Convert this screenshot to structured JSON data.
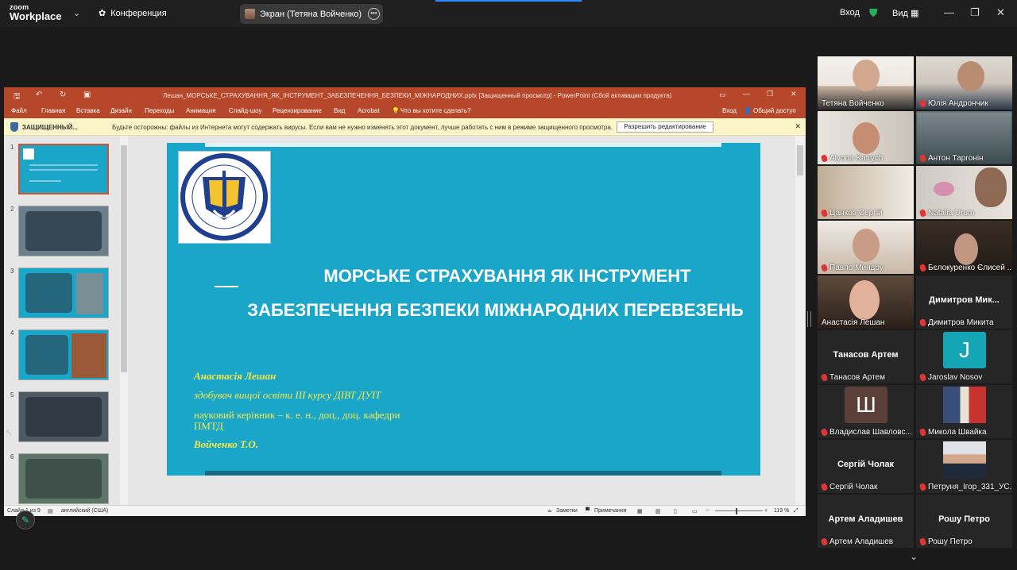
{
  "zoom": {
    "logo_line1": "zoom",
    "logo_line2": "Workplace",
    "meeting_label": "Конференция",
    "screen_share_label": "Экран (Тетяна Войченко)",
    "signin": "Вход",
    "view": "Вид"
  },
  "ppt": {
    "title": "Лешан_МОРСЬКЕ_СТРАХУВАННЯ_ЯК_ІНСТРУМЕНТ_ЗАБЕЗПЕЧЕННЯ_БЕЗПЕКИ_МІЖНАРОДНИХ.pptx [Защищенный просмотр] - PowerPoint (Сбой активации продукта)",
    "ribbon": [
      "Файл",
      "Главная",
      "Вставка",
      "Дизайн",
      "Переходы",
      "Анимация",
      "Слайд-шоу",
      "Рецензирование",
      "Вид",
      "Acrobat"
    ],
    "tell_me": "Что вы хотите сделать?",
    "signin": "Вход",
    "share": "Общий доступ",
    "warn_label": "ЗАЩИЩЕННЫЙ...",
    "warn_msg": "Будьте осторожны: файлы из Интернета могут содержать вирусы. Если вам не нужно изменять этот документ, лучше работать с ним в режиме защищенного просмотра.",
    "enable_edit": "Разрешить редактирование",
    "thumb_numbers": [
      "1",
      "2",
      "3",
      "4",
      "5",
      "6"
    ],
    "status_slide": "Слайд 1 из 9",
    "status_lang": "английский (США)",
    "status_notes": "Заметки",
    "status_comments": "Примечания",
    "zoom_level": "119 %"
  },
  "slide": {
    "title_line1": "МОРСЬКЕ СТРАХУВАННЯ ЯК ІНСТРУМЕНТ",
    "title_line2": "ЗАБЕЗПЕЧЕННЯ БЕЗПЕКИ МІЖНАРОДНИХ ПЕРЕВЕЗЕНЬ",
    "author": "Анастасія Лешан",
    "author_info": "здобувач вищої освіти ІІІ курсу ДІВТ  ДУІТ",
    "advisor_line1": "науковий керівник – к. е. н., доц., доц. кафедри",
    "advisor_line2": "ПМТД",
    "advisor_name": "Войченко Т.О."
  },
  "participants": [
    {
      "name": "Тетяна Войченко",
      "muted": false
    },
    {
      "name": "Юлія Андрончик",
      "muted": true
    },
    {
      "name": "Alyona Katrych",
      "muted": true
    },
    {
      "name": "Антон Таргонін",
      "muted": true
    },
    {
      "name": "Цанков Сергій",
      "muted": true
    },
    {
      "name": "Natalia Urum",
      "muted": true
    },
    {
      "name": "Павло Миндру",
      "muted": true
    },
    {
      "name": "Бєлокуренко Єлисей ...",
      "muted": true
    },
    {
      "name": "Анастасія Лешан",
      "muted": false
    },
    {
      "name": "Димитров Микита",
      "muted": true,
      "big": "Димитров  Мик..."
    },
    {
      "name": "Танасов Артем",
      "muted": true,
      "big": "Танасов Артем"
    },
    {
      "name": "Jaroslav Nosov",
      "muted": true,
      "letter": "J"
    },
    {
      "name": "Владислав Шавловс...",
      "muted": true,
      "letter": "Ш"
    },
    {
      "name": "Микола Швайка",
      "muted": true
    },
    {
      "name": "Сергій Чолак",
      "muted": true,
      "big": "Сергій Чолак"
    },
    {
      "name": "Петруня_Ігор_331_УС...",
      "muted": true
    },
    {
      "name": "Артем Аладишев",
      "muted": true,
      "big": "Артем Аладишев"
    },
    {
      "name": "Рошу Петро",
      "muted": true,
      "big": "Рошу Петро"
    }
  ],
  "colors": {
    "ppt_accent": "#b7472a",
    "slide_bg": "#1aa6c9",
    "slide_subtitle": "#f5e94a",
    "active_speaker": "#23d18b",
    "muted_icon": "#e03535"
  }
}
